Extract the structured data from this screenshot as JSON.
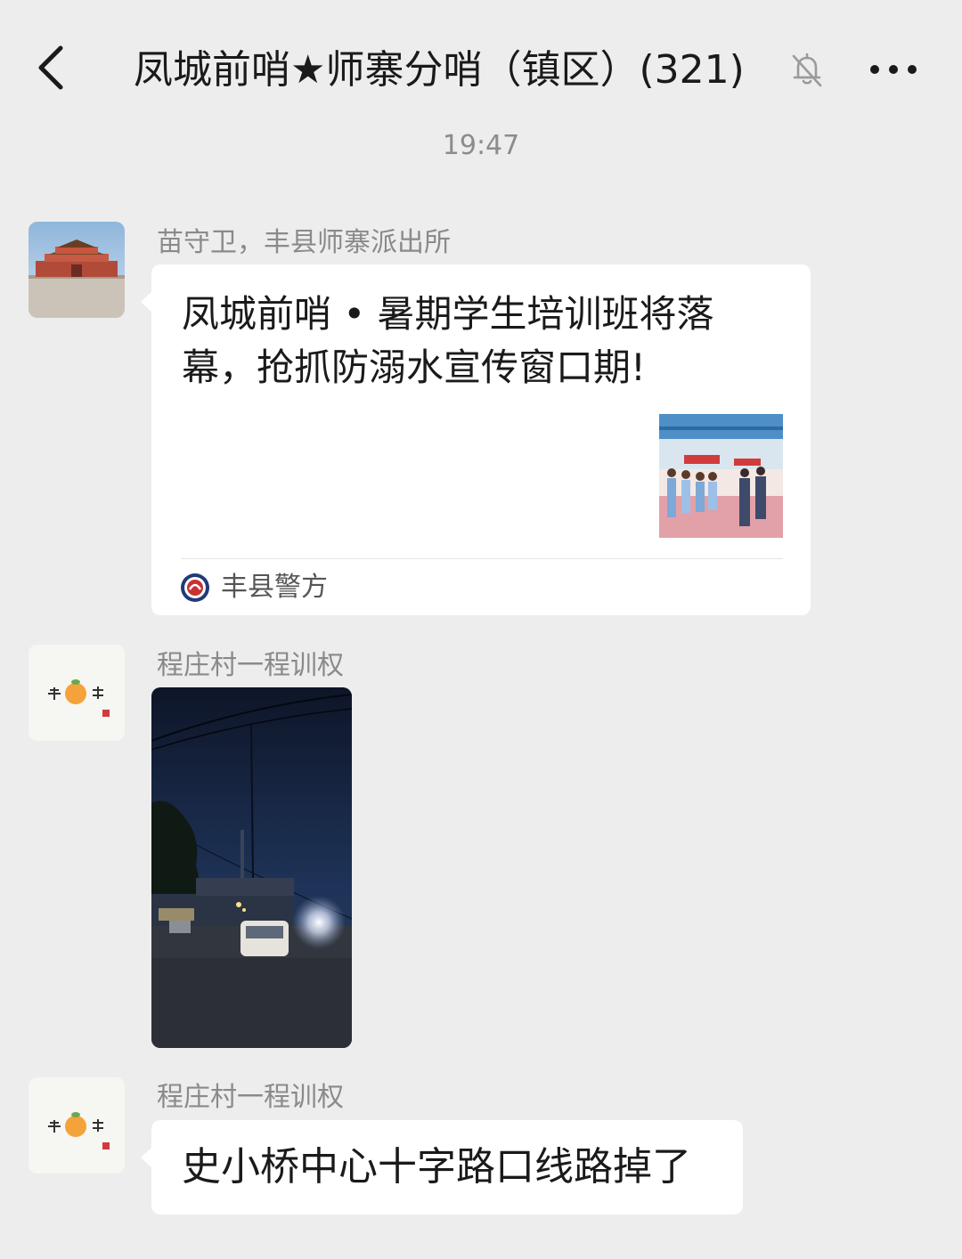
{
  "header": {
    "title": "凤城前哨★师寨分哨（镇区）(321)",
    "back_icon": "chevron-left-icon",
    "mute_icon": "bell-off-icon",
    "more_icon": "more-horizontal-icon"
  },
  "chat": {
    "timestamp": "19:47",
    "messages": [
      {
        "type": "link-card",
        "sender": "苗守卫，丰县师寨派出所",
        "card_title": "凤城前哨 • 暑期学生培训班将落幕，抢抓防溺水宣传窗口期!",
        "card_source": "丰县警方"
      },
      {
        "type": "image",
        "sender": "程庄村一程训权"
      },
      {
        "type": "text",
        "sender": "程庄村一程训权",
        "text": "史小桥中心十字路口线路掉了"
      }
    ]
  },
  "colors": {
    "background": "#ededed",
    "bubble": "#ffffff",
    "secondary_text": "#8a8a8a"
  }
}
